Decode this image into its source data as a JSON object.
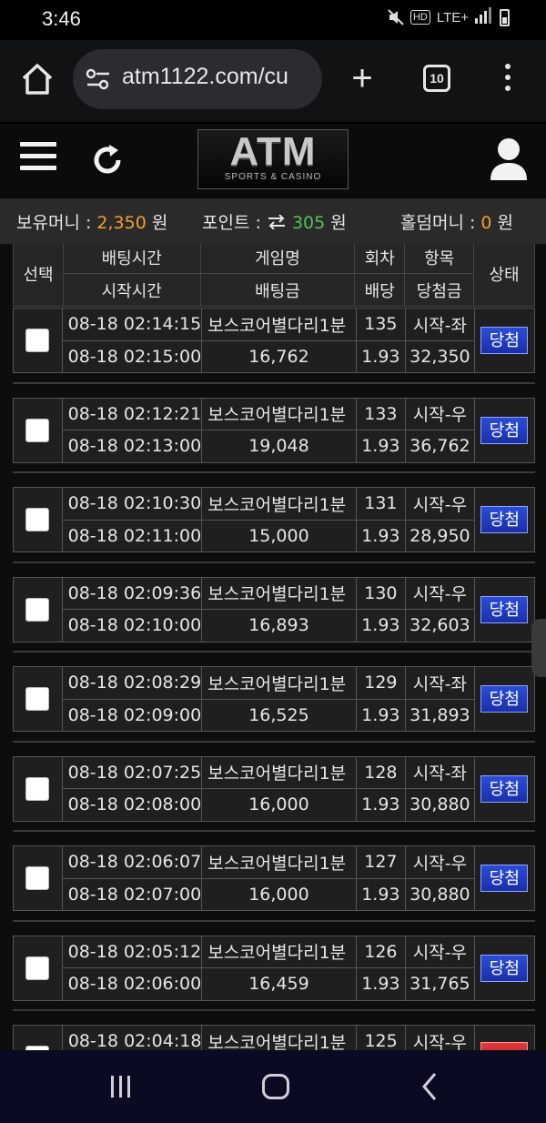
{
  "status_bar": {
    "time": "3:46",
    "network": "LTE+",
    "hd": "HD",
    "icons": [
      "mute-icon",
      "hd-voice-icon",
      "lte-icon",
      "signal-icon",
      "battery-icon"
    ]
  },
  "browser": {
    "url": "atm1122.com/cu",
    "tab_count": "10",
    "icons": [
      "home-icon",
      "site-settings-icon",
      "plus-icon",
      "tabs-icon",
      "more-vert-icon"
    ]
  },
  "site_header": {
    "logo_main": "ATM",
    "logo_sub": "SPORTS & CASINO",
    "icons": [
      "hamburger-icon",
      "refresh-icon",
      "user-icon"
    ]
  },
  "money": {
    "balance_label": "보유머니 : ",
    "balance_value": "2,350",
    "balance_unit": " 원",
    "points_label": "포인트 : ",
    "points_value": "305",
    "points_unit": " 원",
    "holdem_label": "홀덤머니 : ",
    "holdem_value": "0",
    "holdem_unit": " 원"
  },
  "table_header": {
    "select": "선택",
    "bet_time": "배팅시간",
    "start_time": "시작시간",
    "game_name": "게임명",
    "bet_amount": "배팅금",
    "round": "회차",
    "odds": "배당",
    "item": "항목",
    "win_amount": "당첨금",
    "status": "상태"
  },
  "bets": [
    {
      "bet_time": "08-18 02:14:15",
      "start_time": "08-18 02:15:00",
      "game": "보스코어별다리1분",
      "amount": "16,762",
      "round": "135",
      "odds": "1.93",
      "pick": "시작-좌",
      "win": "32,350",
      "status": "당첨"
    },
    {
      "bet_time": "08-18 02:12:21",
      "start_time": "08-18 02:13:00",
      "game": "보스코어별다리1분",
      "amount": "19,048",
      "round": "133",
      "odds": "1.93",
      "pick": "시작-우",
      "win": "36,762",
      "status": "당첨"
    },
    {
      "bet_time": "08-18 02:10:30",
      "start_time": "08-18 02:11:00",
      "game": "보스코어별다리1분",
      "amount": "15,000",
      "round": "131",
      "odds": "1.93",
      "pick": "시작-우",
      "win": "28,950",
      "status": "당첨"
    },
    {
      "bet_time": "08-18 02:09:36",
      "start_time": "08-18 02:10:00",
      "game": "보스코어별다리1분",
      "amount": "16,893",
      "round": "130",
      "odds": "1.93",
      "pick": "시작-우",
      "win": "32,603",
      "status": "당첨"
    },
    {
      "bet_time": "08-18 02:08:29",
      "start_time": "08-18 02:09:00",
      "game": "보스코어별다리1분",
      "amount": "16,525",
      "round": "129",
      "odds": "1.93",
      "pick": "시작-좌",
      "win": "31,893",
      "status": "당첨"
    },
    {
      "bet_time": "08-18 02:07:25",
      "start_time": "08-18 02:08:00",
      "game": "보스코어별다리1분",
      "amount": "16,000",
      "round": "128",
      "odds": "1.93",
      "pick": "시작-좌",
      "win": "30,880",
      "status": "당첨"
    },
    {
      "bet_time": "08-18 02:06:07",
      "start_time": "08-18 02:07:00",
      "game": "보스코어별다리1분",
      "amount": "16,000",
      "round": "127",
      "odds": "1.93",
      "pick": "시작-우",
      "win": "30,880",
      "status": "당첨"
    },
    {
      "bet_time": "08-18 02:05:12",
      "start_time": "08-18 02:06:00",
      "game": "보스코어별다리1분",
      "amount": "16,459",
      "round": "126",
      "odds": "1.93",
      "pick": "시작-우",
      "win": "31,765",
      "status": "당첨"
    },
    {
      "bet_time": "08-18 02:04:18",
      "start_time": "",
      "game": "보스코어별다리1분",
      "amount": "",
      "round": "125",
      "odds": "",
      "pick": "시작-우",
      "win": "",
      "status": ""
    }
  ],
  "colors": {
    "orange": "#f0a030",
    "green": "#4dbb4d",
    "win_badge": "#2b4dd9",
    "lose_badge": "#e03a3a"
  },
  "nav": {
    "icons": [
      "recent-apps-icon",
      "home-circle-icon",
      "back-icon"
    ]
  }
}
